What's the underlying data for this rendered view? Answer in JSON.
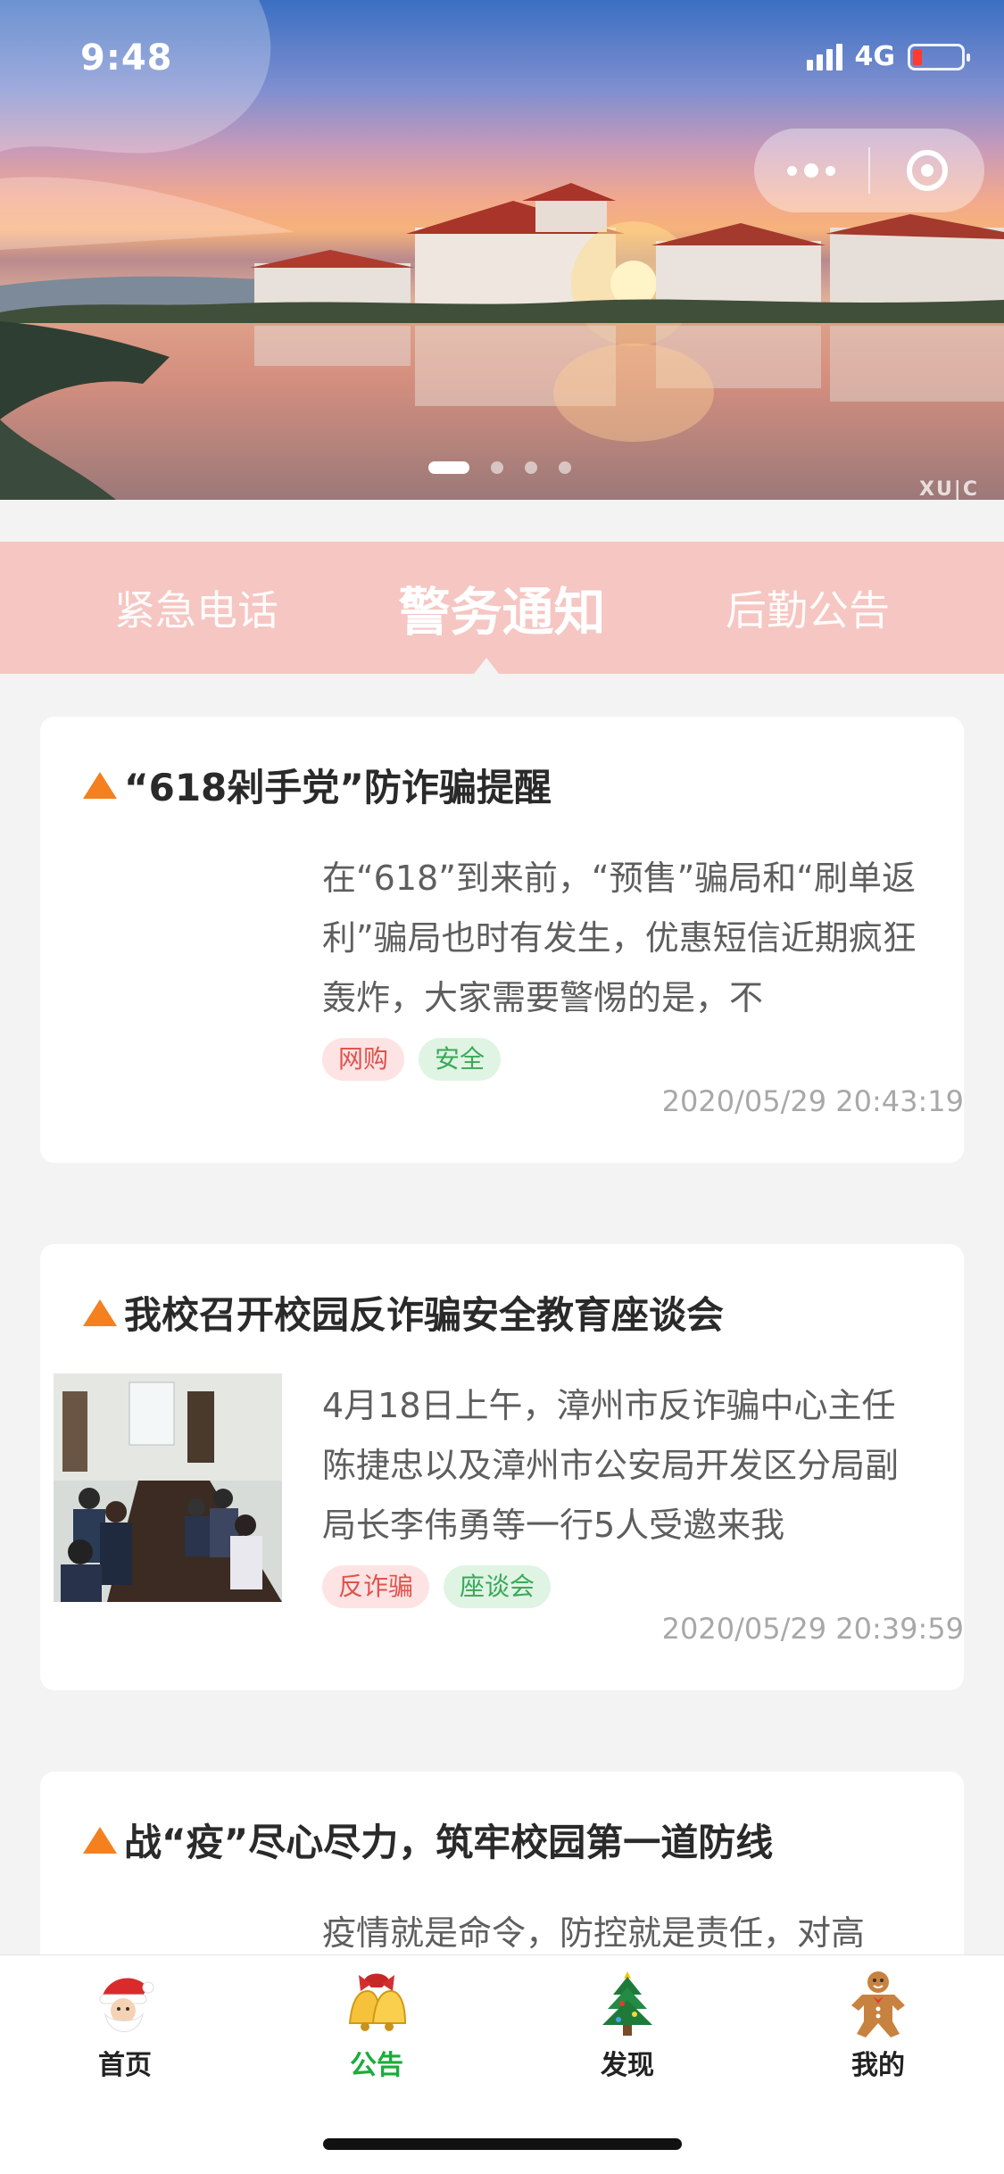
{
  "status_bar": {
    "time": "9:48",
    "network": "4G",
    "battery_level": 0.2,
    "battery_color": "#ff3b30"
  },
  "banner": {
    "watermark": "XU|C",
    "slide_count": 4,
    "active_slide": 0
  },
  "capsule": {
    "more_icon": "more-dots-icon",
    "close_icon": "target-icon"
  },
  "tabs": [
    {
      "label": "紧急电话",
      "active": false
    },
    {
      "label": "警务通知",
      "active": true
    },
    {
      "label": "后勤公告",
      "active": false
    }
  ],
  "notices": [
    {
      "title": "“618剁手党”防诈骗提醒",
      "summary": "在“618”到来前，“预售”骗局和“刷单返利”骗局也时有发生，优惠短信近期疯狂轰炸，大家需要警惕的是，不",
      "tags": [
        "网购",
        "安全"
      ],
      "time": "2020/05/29 20:43:19",
      "has_image": false
    },
    {
      "title": "我校召开校园反诈骗安全教育座谈会",
      "summary": "4月18日上午，漳州市反诈骗中心主任陈捷忠以及漳州市公安局开发区分局副局长李伟勇等一行5人受邀来我",
      "tags": [
        "反诈骗",
        "座谈会"
      ],
      "time": "2020/05/29 20:39:59",
      "has_image": true
    },
    {
      "title": "战“疫”尽心尽力，筑牢校园第一道防线",
      "summary": "疫情就是命令，防控就是责任，对高",
      "tags": [],
      "time": "",
      "has_image": false
    }
  ],
  "tabbar": [
    {
      "label": "首页",
      "icon": "santa-icon",
      "active": false
    },
    {
      "label": "公告",
      "icon": "bell-icon",
      "active": true
    },
    {
      "label": "发现",
      "icon": "christmas-tree-icon",
      "active": false
    },
    {
      "label": "我的",
      "icon": "gingerbread-man-icon",
      "active": false
    }
  ],
  "colors": {
    "accent": "#1aad3a",
    "tab_bg": "#f5c6c2",
    "warning": "#f4801f"
  }
}
